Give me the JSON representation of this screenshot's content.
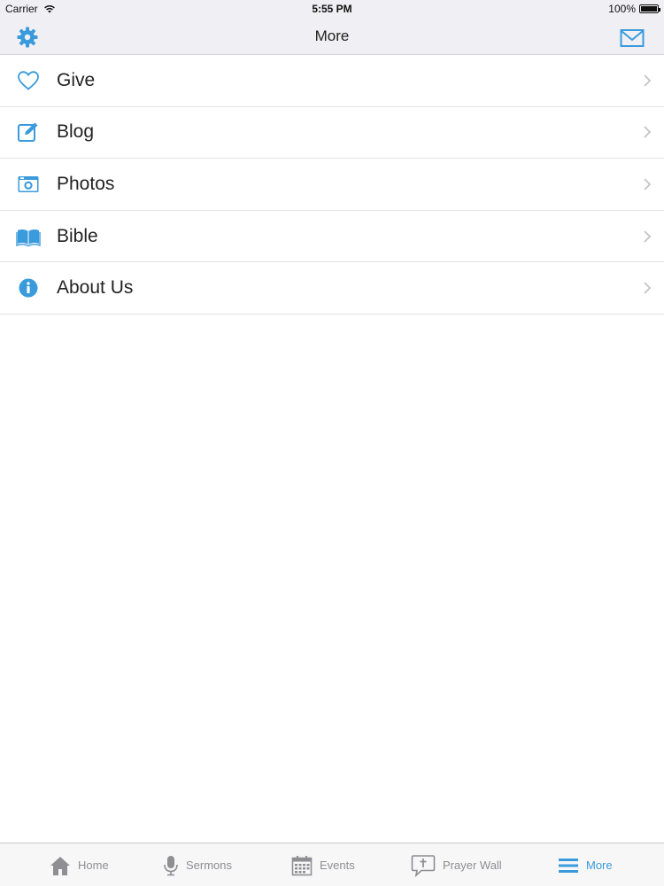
{
  "status_bar": {
    "carrier": "Carrier",
    "time": "5:55 PM",
    "battery": "100%"
  },
  "nav": {
    "title": "More",
    "left_icon": "gear-icon",
    "right_icon": "mail-icon"
  },
  "menu": {
    "items": [
      {
        "label": "Give",
        "icon": "heart-icon"
      },
      {
        "label": "Blog",
        "icon": "edit-icon"
      },
      {
        "label": "Photos",
        "icon": "camera-icon"
      },
      {
        "label": "Bible",
        "icon": "book-icon"
      },
      {
        "label": "About Us",
        "icon": "info-icon"
      }
    ]
  },
  "tabs": {
    "items": [
      {
        "label": "Home",
        "icon": "home-icon",
        "active": false
      },
      {
        "label": "Sermons",
        "icon": "microphone-icon",
        "active": false
      },
      {
        "label": "Events",
        "icon": "calendar-icon",
        "active": false
      },
      {
        "label": "Prayer Wall",
        "icon": "prayer-bubble-icon",
        "active": false
      },
      {
        "label": "More",
        "icon": "menu-lines-icon",
        "active": true
      }
    ]
  },
  "colors": {
    "accent": "#3a9bdc",
    "inactive": "#8e8e93",
    "nav_background": "#efeff4"
  }
}
